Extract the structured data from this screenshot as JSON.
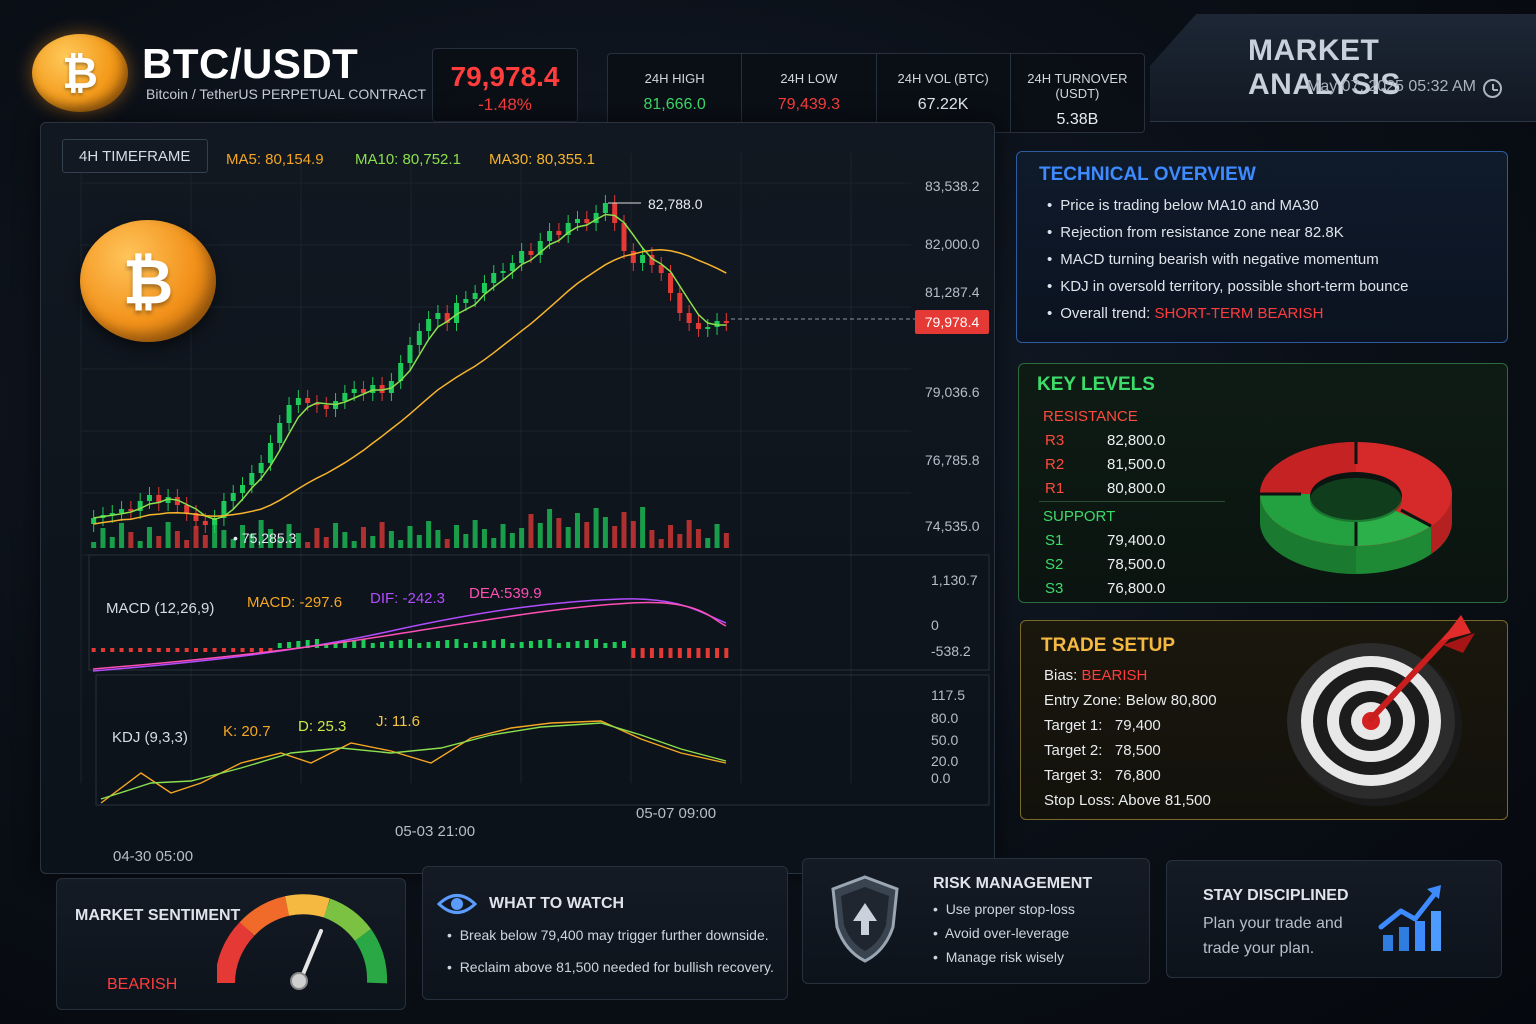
{
  "header": {
    "coin_symbol": "₿",
    "pair": "BTC/USDT",
    "subtitle": "Bitcoin / TetherUS PERPETUAL CONTRACT",
    "price": "79,978.4",
    "change": "-1.48%",
    "stats": [
      {
        "label": "24H HIGH",
        "value": "81,666.0",
        "color": "#3ddc6a"
      },
      {
        "label": "24H LOW",
        "value": "79,439.3",
        "color": "#ff3d3d"
      },
      {
        "label": "24H VOL (BTC)",
        "value": "67.22K",
        "color": "#e8ecf2"
      },
      {
        "label": "24H TURNOVER (USDT)",
        "value": "5.38B",
        "color": "#e8ecf2"
      }
    ],
    "banner_title": "MARKET ANALYSIS",
    "banner_date": "May 07, 2025 05:32 AM"
  },
  "chart": {
    "timeframe": "4H TIMEFRAME",
    "ma5": "MA5: 80,154.9",
    "ma10": "MA10: 80,752.1",
    "ma30": "MA30: 80,355.1",
    "high_marker": "82,788.0",
    "low_marker": "75,285.3",
    "current_price_tag": "79,978.4",
    "price_axis": [
      "83,538.2",
      "82,000.0",
      "81,287.4",
      "79,036.6",
      "76,785.8",
      "74,535.0"
    ],
    "macd_axis": [
      "1,130.7",
      "0",
      "-538.2"
    ],
    "kdj_axis": [
      "117.5",
      "80.0",
      "50.0",
      "20.0",
      "0.0"
    ],
    "time_axis": [
      "04-30 05:00",
      "05-03 21:00",
      "05-07 09:00"
    ],
    "macd_title": "MACD (12,26,9)",
    "macd_val": "MACD: -297.6",
    "dif_val": "DIF: -242.3",
    "dea_val": "DEA:539.9",
    "kdj_title": "KDJ (9,3,3)",
    "k_val": "K: 20.7",
    "d_val": "D: 25.3",
    "j_val": "J: 11.6",
    "colors": {
      "up": "#1ecb5a",
      "down": "#e53935",
      "ma5": "#f5a623",
      "ma10": "#8be04e",
      "ma30": "#f7b42c",
      "dif": "#b14cff",
      "dea": "#ff4fb4"
    }
  },
  "technical": {
    "title": "TECHNICAL OVERVIEW",
    "bullets": [
      "Price is trading below MA10 and MA30",
      "Rejection from resistance zone near 82.8K",
      "MACD turning bearish with negative momentum",
      "KDJ in oversold territory, possible short-term bounce"
    ],
    "trend_label": "Overall trend: ",
    "trend_value": "SHORT-TERM BEARISH"
  },
  "levels": {
    "title": "KEY LEVELS",
    "resistance_label": "RESISTANCE",
    "resistance": [
      {
        "name": "R3",
        "value": "82,800.0"
      },
      {
        "name": "R2",
        "value": "81,500.0"
      },
      {
        "name": "R1",
        "value": "80,800.0"
      }
    ],
    "support_label": "SUPPORT",
    "support": [
      {
        "name": "S1",
        "value": "79,400.0"
      },
      {
        "name": "S2",
        "value": "78,500.0"
      },
      {
        "name": "S3",
        "value": "76,800.0"
      }
    ]
  },
  "trade": {
    "title": "TRADE SETUP",
    "bias_label": "Bias: ",
    "bias_value": "BEARISH",
    "rows": [
      {
        "label": "Entry Zone:",
        "value": "Below 80,800"
      },
      {
        "label": "Target 1:",
        "value": "79,400"
      },
      {
        "label": "Target 2:",
        "value": "78,500"
      },
      {
        "label": "Target 3:",
        "value": "76,800"
      },
      {
        "label": "Stop Loss:",
        "value": "Above 81,500"
      }
    ]
  },
  "bottom": {
    "sentiment_title": "MARKET SENTIMENT",
    "sentiment_value": "BEARISH",
    "watch_title": "WHAT TO WATCH",
    "watch_items": [
      "Break below 79,400 may trigger further downside.",
      "Reclaim above 81,500 needed for bullish recovery."
    ],
    "risk_title": "RISK MANAGEMENT",
    "risk_items": [
      "Use proper stop-loss",
      "Avoid over-leverage",
      "Manage risk wisely"
    ],
    "disc_title": "STAY DISCIPLINED",
    "disc_line1": "Plan your trade and",
    "disc_line2": "trade your plan."
  }
}
